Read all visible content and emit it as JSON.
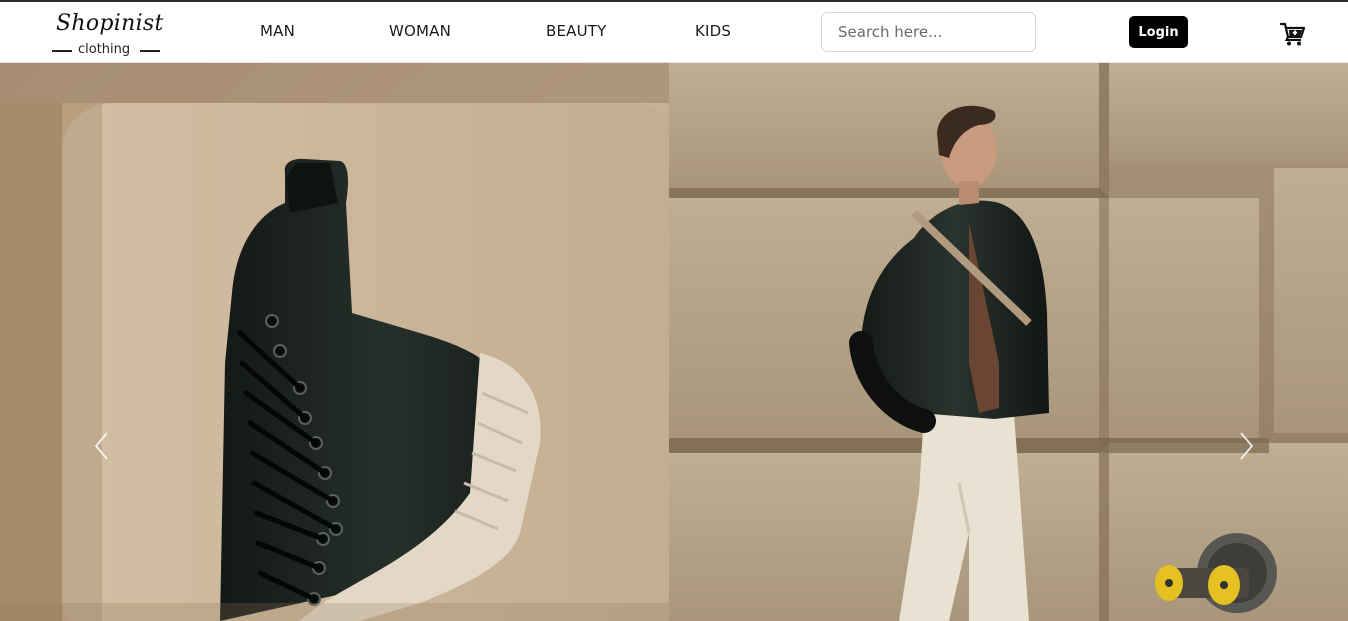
{
  "brand": {
    "name": "Shopinist",
    "tagline": "clothing"
  },
  "nav": {
    "items": [
      {
        "label": "MAN"
      },
      {
        "label": "WOMAN"
      },
      {
        "label": "BEAUTY"
      },
      {
        "label": "KIDS"
      }
    ]
  },
  "search": {
    "placeholder": "Search here...",
    "value": ""
  },
  "auth": {
    "login_label": "Login"
  },
  "cart": {
    "icon": "cart-plus-icon"
  },
  "carousel": {
    "prev_icon": "chevron-left-icon",
    "next_icon": "chevron-right-icon",
    "slides": [
      {
        "image": "black-high-top-sneaker-photo"
      },
      {
        "image": "man-leather-jacket-photo"
      }
    ]
  },
  "colors": {
    "login_bg": "#000000",
    "accent_text": "#111111"
  }
}
